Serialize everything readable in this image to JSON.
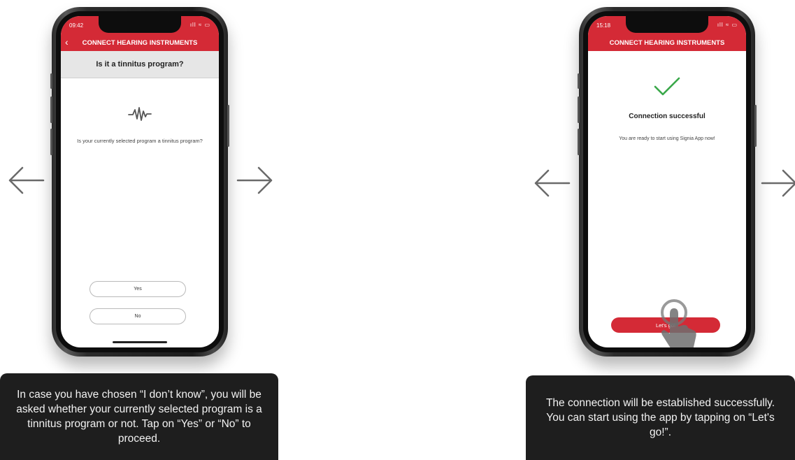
{
  "left": {
    "status_time": "09:42",
    "status_icons": "ıll ≈ ▭",
    "screen_title": "CONNECT HEARING INSTRUMENTS",
    "question": "Is it a tinnitus program?",
    "waveform_icon": "waveform-icon",
    "body": "Is your currently selected program a tinnitus program?",
    "yes_label": "Yes",
    "no_label": "No",
    "caption": "In case you have chosen “I don’t know”, you will be asked whether your currently selected program is a tinnitus program or not. Tap on “Yes” or “No” to proceed."
  },
  "right": {
    "status_time": "15:18",
    "status_icons": "ıll ≈ ▭",
    "screen_title": "CONNECT HEARING INSTRUMENTS",
    "success_heading": "Connection successful",
    "body": "You are ready to start using Signia App now!",
    "button_label": "Let's go!",
    "caption": "The connection will be established successfully. You can start using the app by tapping on “Let's go!”."
  },
  "colors": {
    "brand_red": "#d42a36",
    "success_green": "#3aa84a",
    "caption_bg": "#1e1e1e"
  }
}
